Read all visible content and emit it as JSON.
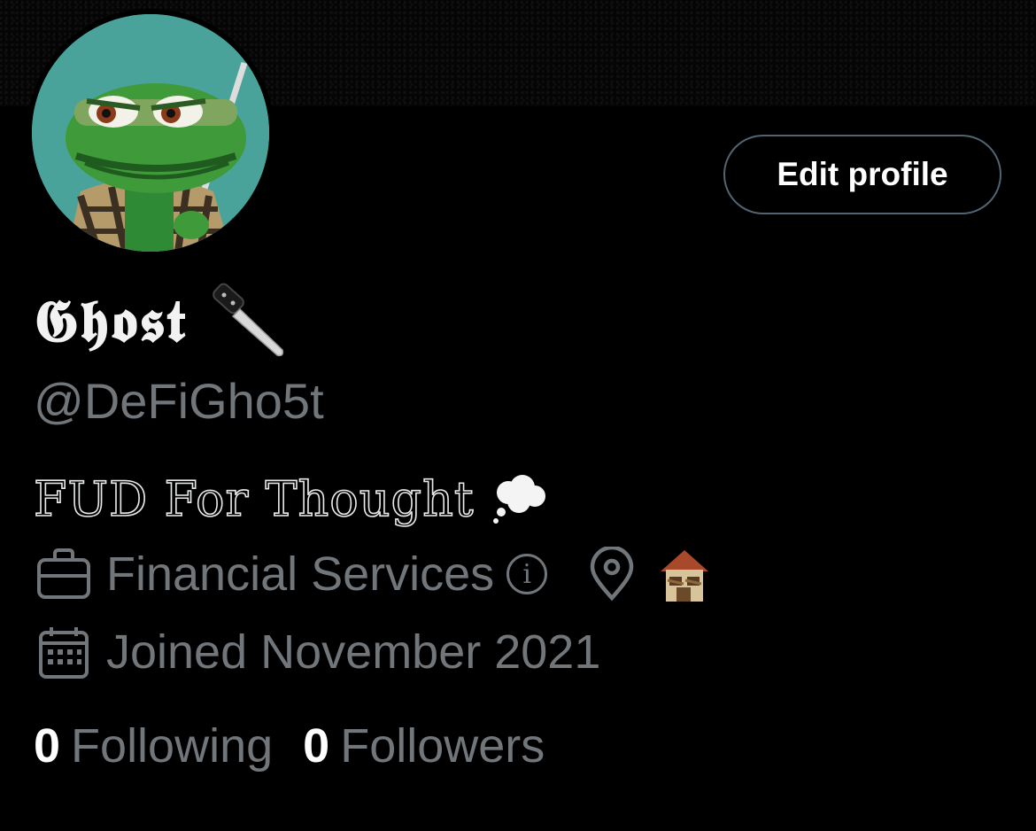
{
  "profile": {
    "display_name": "𝕲𝖍𝖔𝖘𝖙",
    "handle": "@DeFiGho5t",
    "bio": "FUD For Thought",
    "category": "Financial Services",
    "joined": "Joined November 2021",
    "edit_label": "Edit profile"
  },
  "stats": {
    "following_count": "0",
    "following_label": "Following",
    "followers_count": "0",
    "followers_label": "Followers"
  },
  "icons": {
    "name_emoji": "knife-icon",
    "bio_emoji": "thought-balloon-icon",
    "category": "briefcase-icon",
    "category_info": "info-icon",
    "location": "location-pin-icon",
    "location_emoji": "derelict-house-icon",
    "joined": "calendar-icon"
  },
  "colors": {
    "background": "#000000",
    "secondary_text": "#71767b",
    "primary_text": "#e7e9ea",
    "button_border": "#536471",
    "avatar_bg": "#4aa39a"
  }
}
